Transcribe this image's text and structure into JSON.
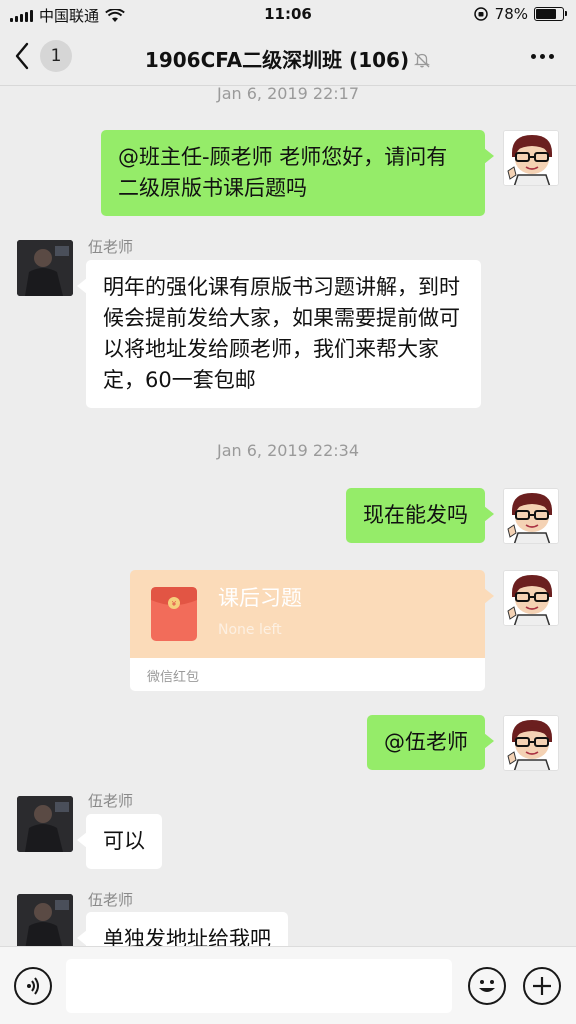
{
  "status_bar": {
    "carrier": "中国联通",
    "time": "11:06",
    "battery_percent": "78%",
    "battery_level": 0.78
  },
  "nav": {
    "unread_count": "1",
    "title": "1906CFA二级深圳班 (106)",
    "muted": true
  },
  "messages": {
    "ts1": "Jan 6, 2019 22:17",
    "m1": "@班主任-顾老师 老师您好，请问有二级原版书课后题吗",
    "m2_sender": "伍老师",
    "m2": "明年的强化课有原版书习题讲解，到时候会提前发给大家，如果需要提前做可以将地址发给顾老师，我们来帮大家定，60一套包邮",
    "ts2": "Jan 6, 2019 22:34",
    "m3": "现在能发吗",
    "redpacket": {
      "title": "课后习题",
      "status": "None left",
      "footer": "微信红包"
    },
    "m5": "@伍老师",
    "m6_sender": "伍老师",
    "m6": "可以",
    "m7_sender": "伍老师",
    "m7": "单独发地址给我吧"
  },
  "colors": {
    "outgoing_bubble": "#95ec69",
    "incoming_bubble": "#ffffff",
    "redpacket": "#fbdbb9",
    "background": "#ededed"
  },
  "icons": {
    "back": "chevron-left-icon",
    "mute": "bell-muted-icon",
    "more": "more-dots-icon",
    "voice": "voice-icon",
    "emoji": "emoji-icon",
    "plus": "plus-icon"
  }
}
